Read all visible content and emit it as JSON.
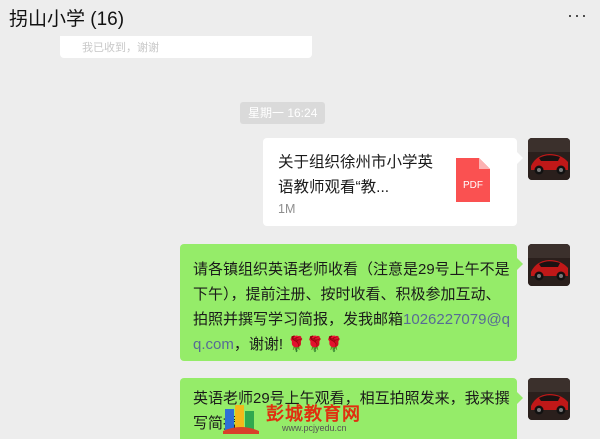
{
  "header": {
    "title": "拐山小学 (16)",
    "more_label": "···"
  },
  "previous_message": {
    "text": "我已收到，谢谢"
  },
  "timestamp": "星期一 16:24",
  "file_message": {
    "name": "关于组织徐州市小学英语教师观看“教...",
    "size": "1M",
    "file_icon_label": "PDF",
    "file_icon_color": "#fa5151"
  },
  "messages": [
    {
      "text_before_link": "请各镇组织英语老师收看（注意是29号上午不是下午），提前注册、按时收看、积极参加互动、拍照并撰写学习简报，发我邮箱",
      "link": "1026227079@qq.com",
      "text_after_link": "，谢谢!",
      "emoji": "🌹🌹🌹"
    },
    {
      "text": "英语老师29号上午观看，相互拍照发来，我来撰写简报"
    }
  ],
  "watermark": {
    "name": "彭城教育网",
    "url": "www.pcjyedu.cn"
  },
  "colors": {
    "chat_background": "#ededed",
    "sent_bubble": "#95ec69",
    "link": "#576b95"
  }
}
